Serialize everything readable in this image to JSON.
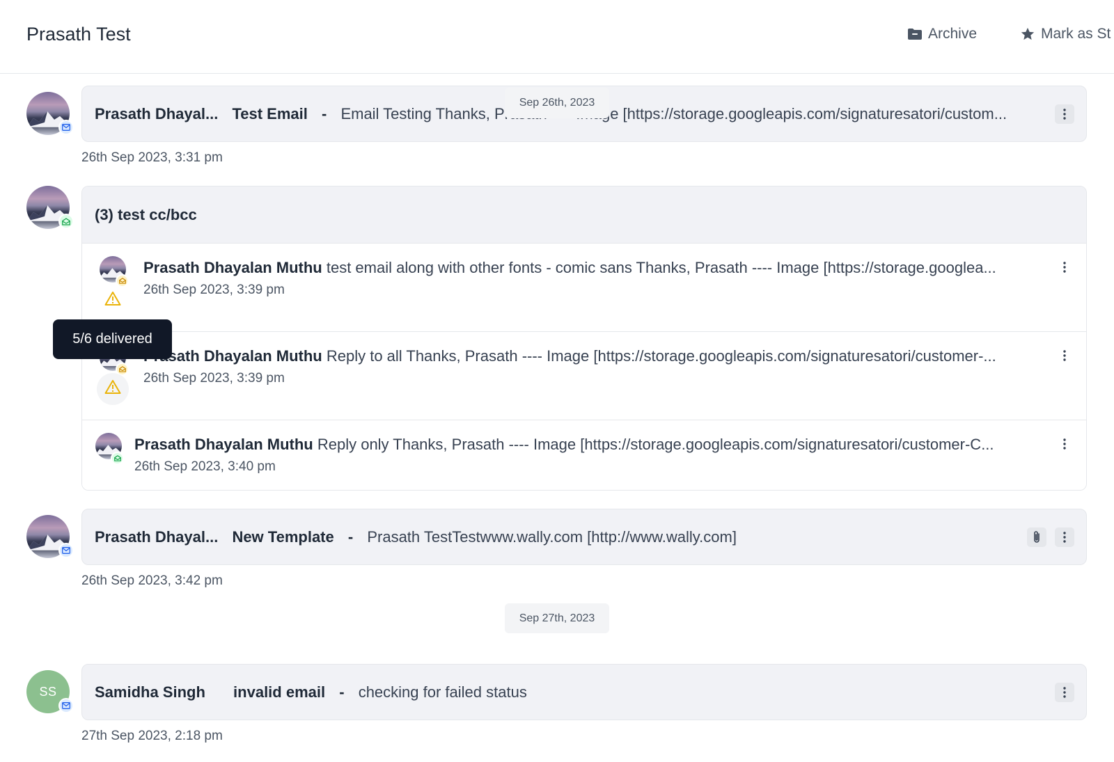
{
  "header": {
    "title": "Prasath Test",
    "archive_label": "Archive",
    "star_label": "Mark as St"
  },
  "emails": [
    {
      "sender": "Prasath Dhayal...",
      "subject": "Test Email",
      "separator": "-",
      "preview": "Email Testing Thanks, Prasath ---- Image [https://storage.googleapis.com/signaturesatori/custom...",
      "timestamp": "26th Sep 2023, 3:31 pm",
      "badge": "mail-icon"
    },
    {
      "sender": "Prasath Dhayal...",
      "subject": "New Template",
      "separator": "-",
      "preview": "Prasath TestTestwww.wally.com [http://www.wally.com]",
      "timestamp": "26th Sep 2023, 3:42 pm",
      "badge": "mail-icon",
      "has_attachment": true
    },
    {
      "sender": "Samidha Singh",
      "initials": "SS",
      "subject": "invalid email",
      "separator": "-",
      "preview": "checking for failed status",
      "timestamp": "27th Sep 2023, 2:18 pm",
      "badge": "mail-icon"
    }
  ],
  "date_separators": [
    "Sep 26th, 2023",
    "Sep 27th, 2023"
  ],
  "thread": {
    "title": "(3) test cc/bcc",
    "messages": [
      {
        "sender": "Prasath Dhayalan Muthu",
        "preview": "test email along with other fonts - comic sans Thanks, Prasath ---- Image [https://storage.googlea...",
        "timestamp": "26th Sep 2023, 3:39 pm",
        "status": "warning"
      },
      {
        "sender": "Prasath Dhayalan Muthu",
        "preview": "Reply to all Thanks, Prasath ---- Image [https://storage.googleapis.com/signaturesatori/customer-...",
        "timestamp": "26th Sep 2023, 3:39 pm",
        "status": "warning"
      },
      {
        "sender": "Prasath Dhayalan Muthu",
        "preview": "Reply only Thanks, Prasath ---- Image [https://storage.googleapis.com/signaturesatori/customer-C...",
        "timestamp": "26th Sep 2023, 3:40 pm",
        "status": "opened"
      }
    ]
  },
  "tooltip": "5/6 delivered",
  "colors": {
    "card_bg": "#f1f2f6",
    "warning": "#eab308",
    "tooltip_bg": "#111827",
    "avatar_ss": "#8cc08f"
  }
}
